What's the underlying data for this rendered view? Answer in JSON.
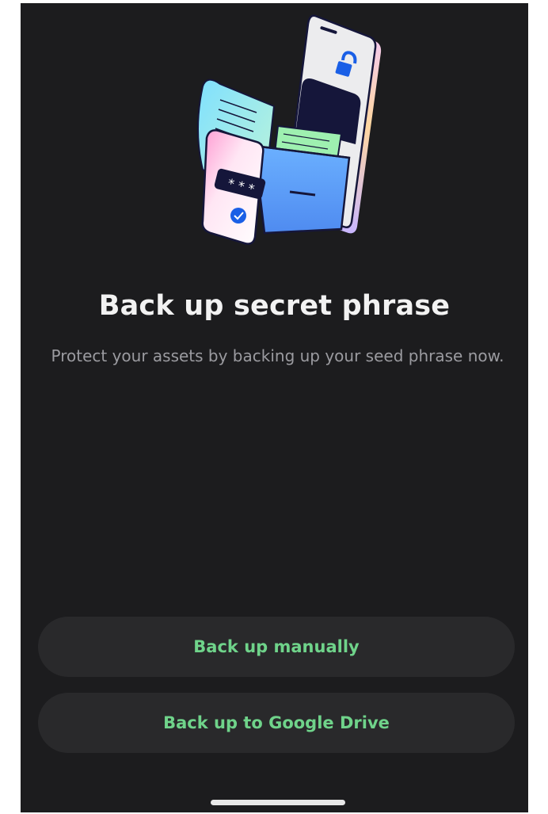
{
  "onboarding": {
    "title": "Back up secret phrase",
    "subtitle": "Protect your assets by backing up your seed phrase now.",
    "illustration": "phone-folder-backup-illustration"
  },
  "actions": {
    "manual_label": "Back up manually",
    "drive_label": "Back up to Google Drive"
  },
  "colors": {
    "background": "#1c1c1e",
    "button_background": "#29292b",
    "accent_green": "#6fd38a",
    "title_text": "#f2f2f2",
    "subtitle_text": "#9b9ba0"
  },
  "icons": {
    "illustration": "backup-illustration",
    "lock": "unlocked-padlock-icon",
    "check": "check-icon"
  }
}
